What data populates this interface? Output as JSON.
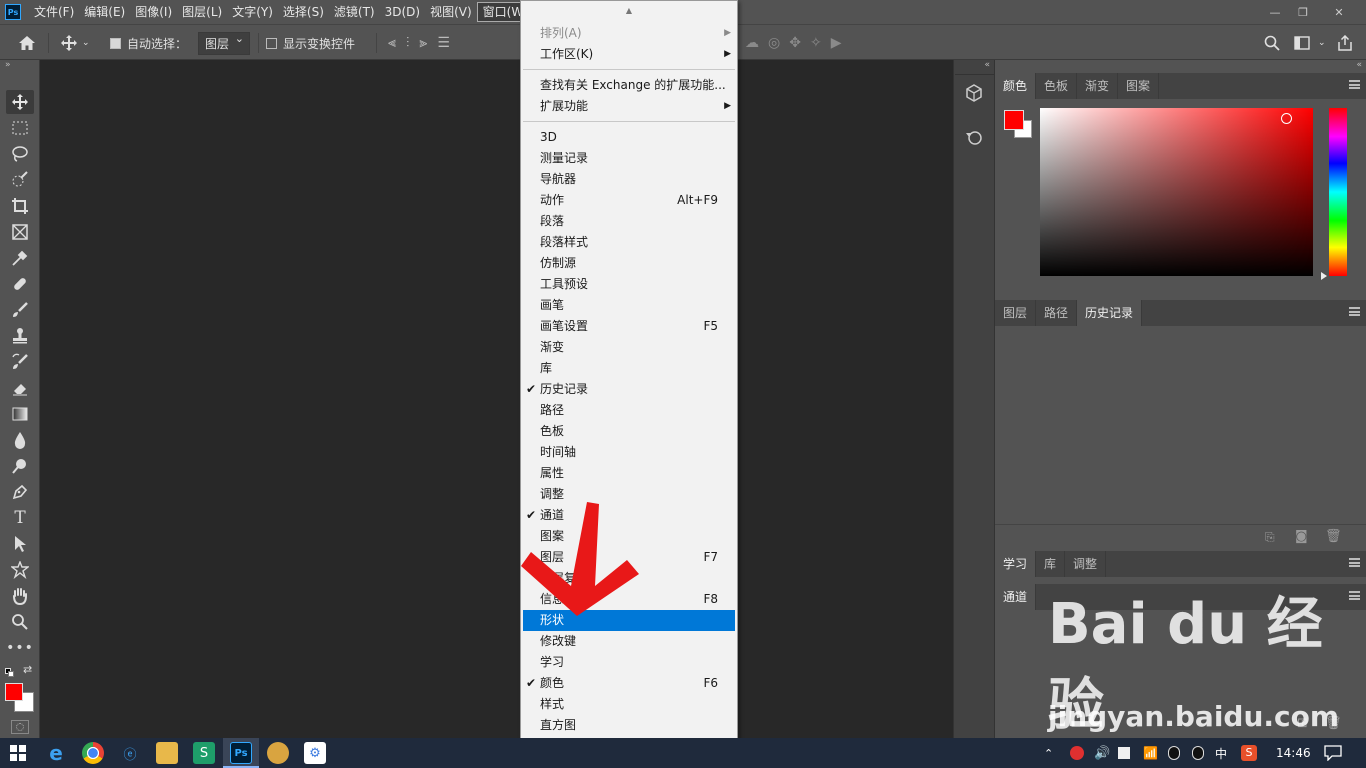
{
  "app": {
    "logo_text": "Ps"
  },
  "menubar": {
    "items": [
      "文件(F)",
      "编辑(E)",
      "图像(I)",
      "图层(L)",
      "文字(Y)",
      "选择(S)",
      "滤镜(T)",
      "3D(D)",
      "视图(V)",
      "窗口(W)"
    ],
    "active": "窗口(W)",
    "window_controls": [
      "—",
      "❐",
      "✕"
    ]
  },
  "options": {
    "auto_select_label": "自动选择：",
    "auto_select_checked": true,
    "auto_select_target": "图层",
    "show_transform_label": "显示变换控件",
    "show_transform_checked": false
  },
  "window_menu": {
    "top_arrow": "▲",
    "bottom_arrow": "▼",
    "groups": [
      [
        {
          "label": "排列(A)",
          "disabled": true,
          "submenu": true
        },
        {
          "label": "工作区(K)",
          "submenu": true
        }
      ],
      [
        {
          "label": "查找有关 Exchange 的扩展功能..."
        },
        {
          "label": "扩展功能",
          "submenu": true
        }
      ],
      [
        {
          "label": "3D"
        },
        {
          "label": "测量记录"
        },
        {
          "label": "导航器"
        },
        {
          "label": "动作",
          "shortcut": "Alt+F9"
        },
        {
          "label": "段落"
        },
        {
          "label": "段落样式"
        },
        {
          "label": "仿制源"
        },
        {
          "label": "工具预设"
        },
        {
          "label": "画笔"
        },
        {
          "label": "画笔设置",
          "shortcut": "F5"
        },
        {
          "label": "渐变"
        },
        {
          "label": "库"
        },
        {
          "label": "历史记录",
          "checked": true
        },
        {
          "label": "路径"
        },
        {
          "label": "色板"
        },
        {
          "label": "时间轴"
        },
        {
          "label": "属性"
        },
        {
          "label": "调整"
        },
        {
          "label": "通道",
          "checked": true
        },
        {
          "label": "图案"
        },
        {
          "label": "图层",
          "shortcut": "F7"
        },
        {
          "label": "图层复合"
        },
        {
          "label": "信息",
          "shortcut": "F8"
        },
        {
          "label": "形状",
          "highlighted": true
        },
        {
          "label": "修改键"
        },
        {
          "label": "学习"
        },
        {
          "label": "颜色",
          "shortcut": "F6",
          "checked": true
        },
        {
          "label": "样式"
        },
        {
          "label": "直方图"
        }
      ]
    ]
  },
  "panels": {
    "color_tabs": [
      "颜色",
      "色板",
      "渐变",
      "图案"
    ],
    "color_active": "颜色",
    "history_tabs": [
      "图层",
      "路径",
      "历史记录"
    ],
    "history_active": "历史记录",
    "learn_tabs": [
      "学习",
      "库",
      "调整"
    ],
    "learn_active": "学习",
    "channels_tabs": [
      "通道"
    ],
    "channels_active": "通道"
  },
  "colors": {
    "foreground": "#ff0000",
    "background": "#ffffff",
    "menu_highlight": "#0078d7",
    "arrow": "#e81818"
  },
  "taskbar": {
    "time": "14:46",
    "ime": "中",
    "apps": [
      "ie-icon",
      "chrome-icon",
      "edge-icon",
      "folder-icon",
      "sheets-icon",
      "photoshop-icon",
      "paint-icon",
      "app-icon"
    ]
  },
  "watermark": {
    "logo": "Bai du 经验",
    "url": "jingyan.baidu.com"
  }
}
